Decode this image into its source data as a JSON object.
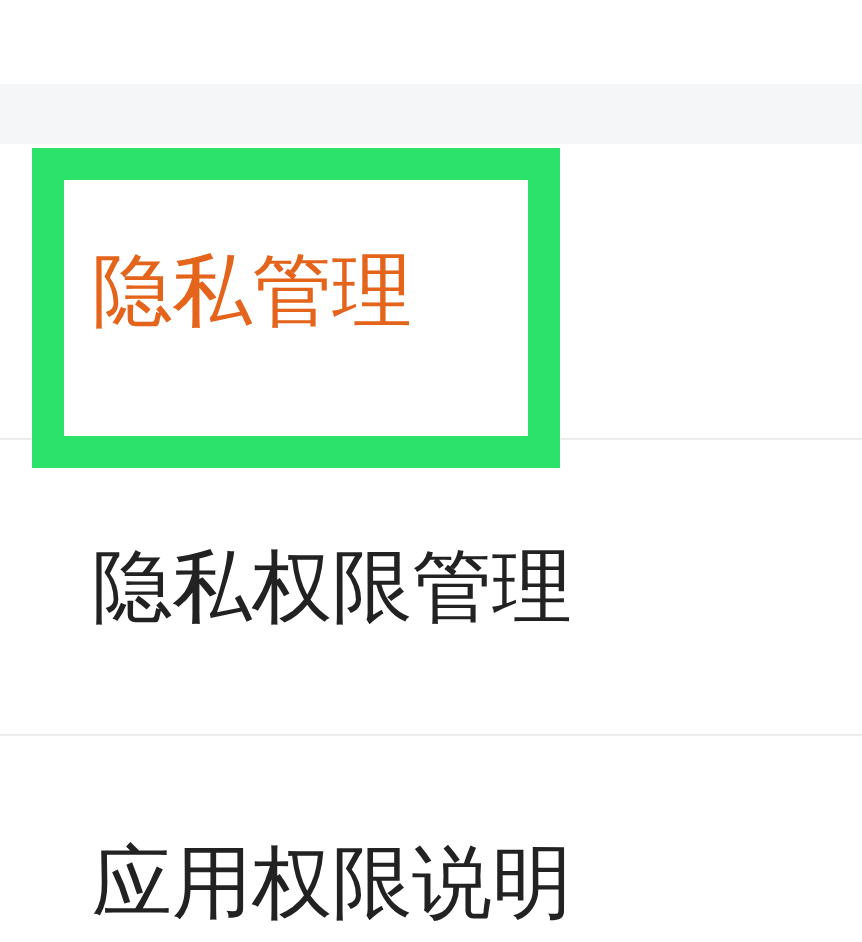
{
  "rows": [
    {
      "kind": "header",
      "label": "隐私管理",
      "highlighted": true
    },
    {
      "kind": "item",
      "label": "隐私权限管理",
      "highlighted": false
    },
    {
      "kind": "item",
      "label": "应用权限说明",
      "highlighted": false
    }
  ]
}
